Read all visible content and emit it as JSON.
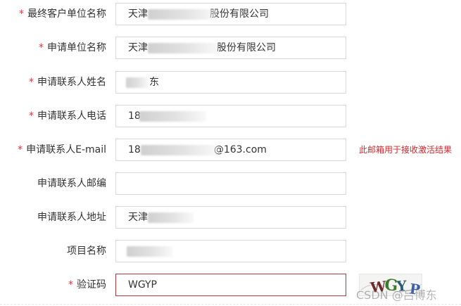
{
  "form": {
    "fields": [
      {
        "label": "最终客户单位名称",
        "required": true,
        "value_prefix": "天津",
        "value_suffix": "股份有限公司"
      },
      {
        "label": "申请单位名称",
        "required": true,
        "value_prefix": "天津",
        "value_suffix": "股份有限公司"
      },
      {
        "label": "申请联系人姓名",
        "required": true,
        "value_prefix": "",
        "value_suffix": "东"
      },
      {
        "label": "申请联系人电话",
        "required": true,
        "value_prefix": "18",
        "value_suffix": ""
      },
      {
        "label": "申请联系人E-mail",
        "required": true,
        "value_prefix": "18",
        "value_suffix": "@163.com"
      },
      {
        "label": "申请联系人邮编",
        "required": false,
        "value_prefix": "",
        "value_suffix": ""
      },
      {
        "label": "申请联系人地址",
        "required": false,
        "value_prefix": "天津",
        "value_suffix": ""
      },
      {
        "label": "项目名称",
        "required": false,
        "value_prefix": "",
        "value_suffix": ""
      },
      {
        "label": "验证码",
        "required": true,
        "value_prefix": "WGYP",
        "value_suffix": ""
      }
    ],
    "required_mark": "*",
    "email_hint": "此邮箱用于接收激活结果",
    "captcha_text": "WGYP"
  },
  "colors": {
    "required": "#e0393e",
    "hint": "#d3282d",
    "error_border": "#b33a3a"
  },
  "watermark": "CSDN @吕博东"
}
